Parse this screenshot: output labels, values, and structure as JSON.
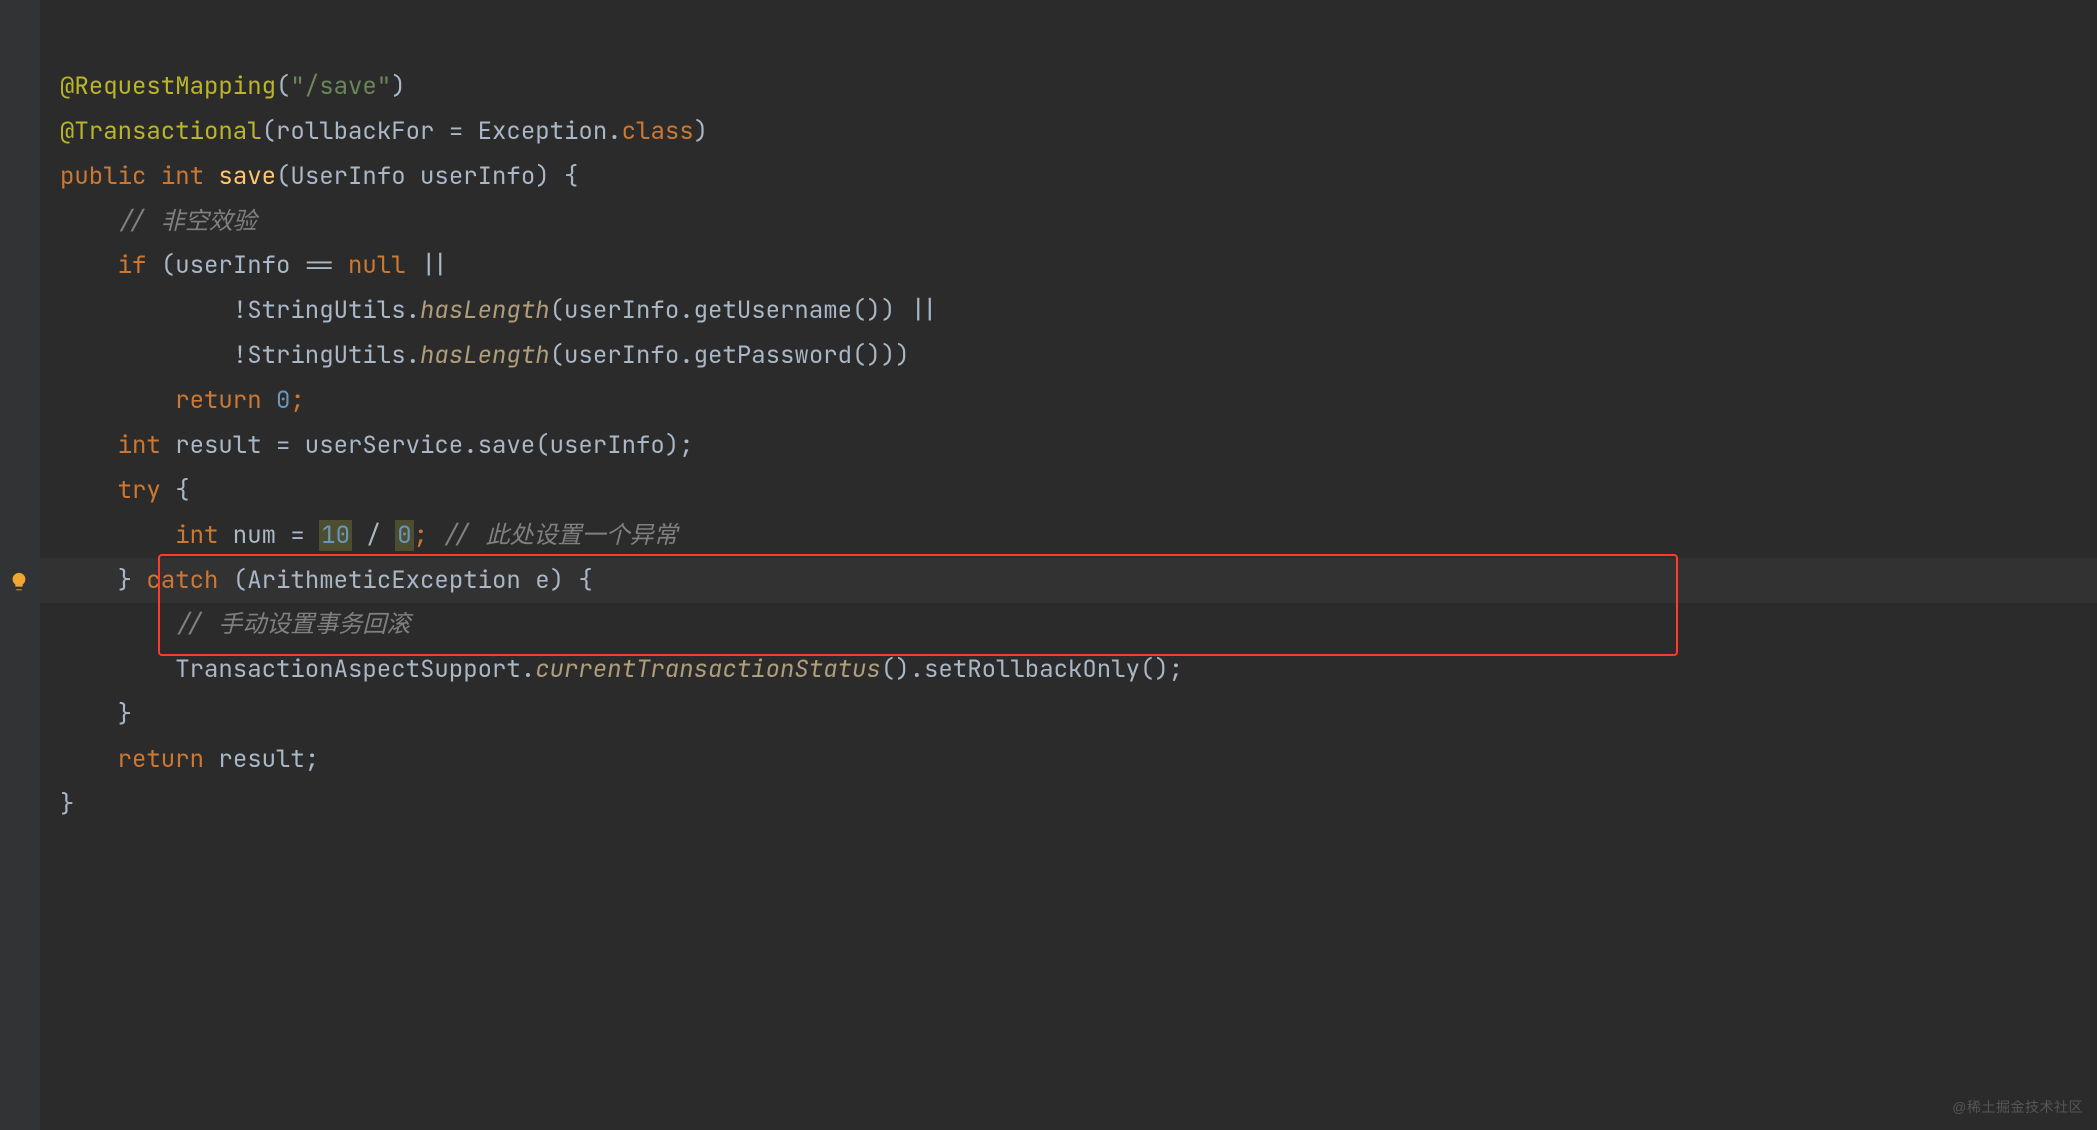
{
  "code": {
    "l1": {
      "ann": "@RequestMapping",
      "paren1": "(",
      "str": "\"/save\"",
      "paren2": ")"
    },
    "l2": {
      "ann": "@Transactional",
      "paren1": "(",
      "param": "rollbackFor",
      "eq": " = ",
      "cls": "Exception",
      "dot": ".",
      "kw": "class",
      "paren2": ")"
    },
    "l3": {
      "kw1": "public",
      "sp1": " ",
      "kw2": "int",
      "sp2": " ",
      "fn": "save",
      "sig": "(UserInfo userInfo) {"
    },
    "l4": {
      "cmt": "// 非空效验"
    },
    "l5": {
      "kw": "if",
      "rest": " (userInfo == ",
      "kw2": "null",
      "rest2": " ||"
    },
    "l6": {
      "pre": "        !StringUtils.",
      "mth": "hasLength",
      "post": "(userInfo.getUsername()) ||"
    },
    "l7": {
      "pre": "        !StringUtils.",
      "mth": "hasLength",
      "post": "(userInfo.getPassword()))"
    },
    "l8": {
      "kw": "return",
      "sp": " ",
      "num": "0",
      "semi": ";"
    },
    "l9": {
      "kw": "int",
      "rest": " result = userService.save(userInfo);"
    },
    "l10": {
      "kw": "try",
      "rest": " {"
    },
    "l11": {
      "kw": "int",
      "rest": " num = ",
      "num1": "10",
      "op": " / ",
      "num2": "0",
      "semi": "; ",
      "cmt": "// 此处设置一个异常"
    },
    "l12": {
      "close": "} ",
      "kw": "catch",
      "rest": " (ArithmeticException e) {"
    },
    "l13": {
      "cmt": "// 手动设置事务回滚"
    },
    "l14": {
      "pre": "TransactionAspectSupport.",
      "mth": "currentTransactionStatus",
      "post": "().setRollbackOnly();"
    },
    "l15": {
      "close": "}"
    },
    "l16": {
      "kw": "return",
      "rest": " result;"
    },
    "l17": {
      "close": "}"
    }
  },
  "watermark": "@稀土掘金技术社区"
}
